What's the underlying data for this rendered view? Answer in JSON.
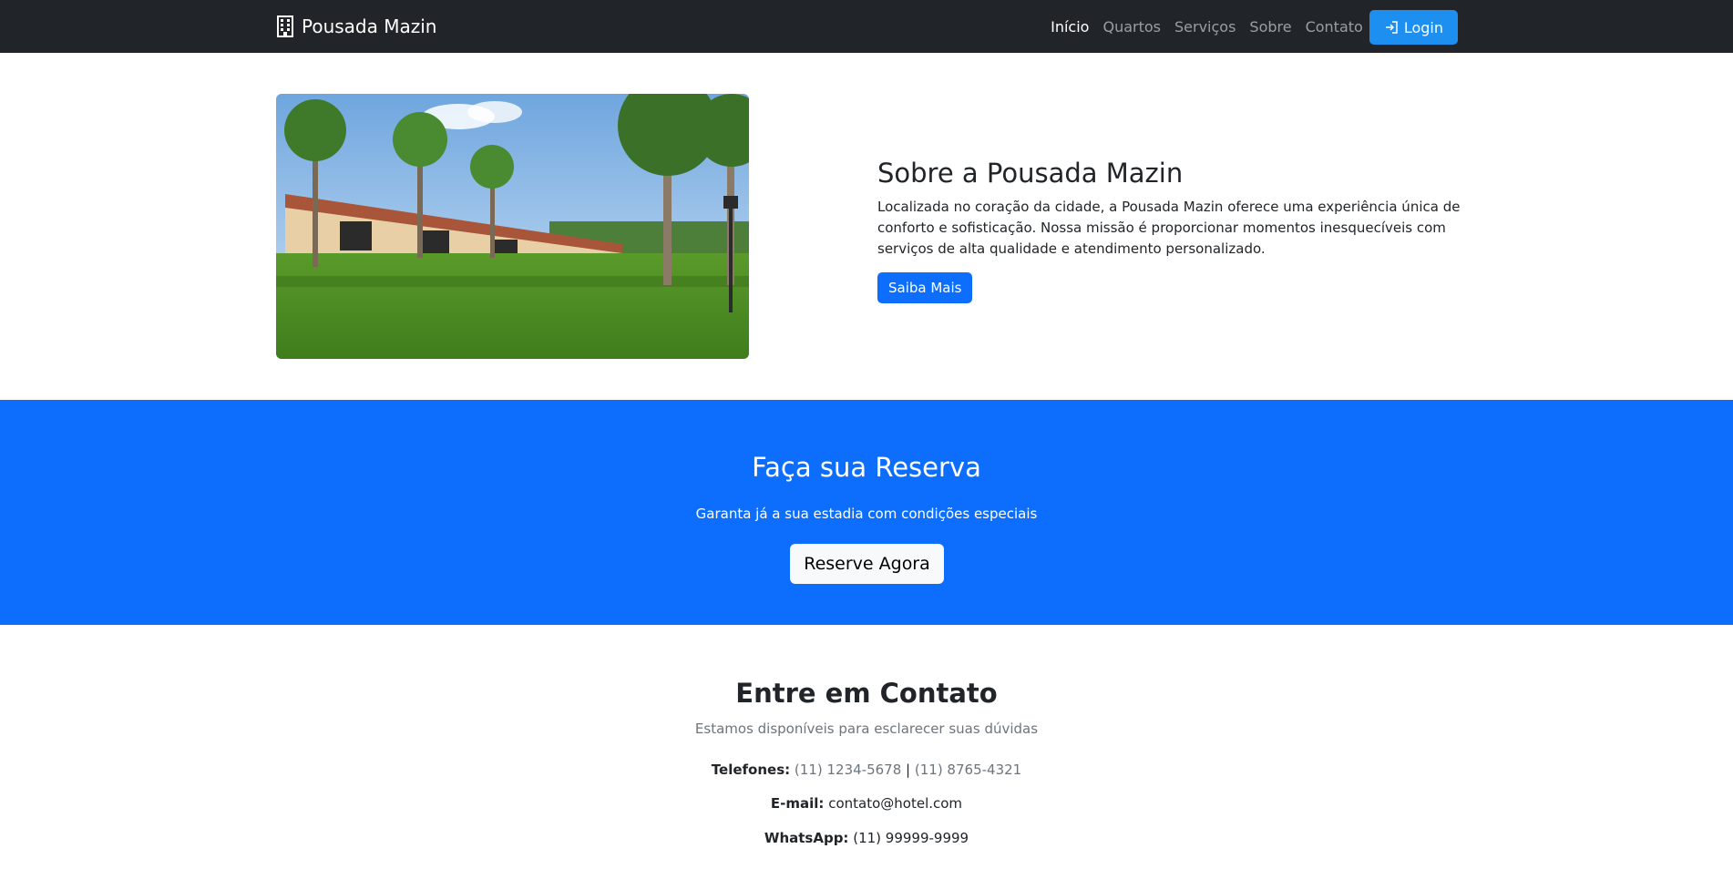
{
  "navbar": {
    "brand": "Pousada Mazin",
    "links": [
      "Início",
      "Quartos",
      "Serviços",
      "Sobre",
      "Contato"
    ],
    "login_label": "Login"
  },
  "about": {
    "title": "Sobre a Pousada Mazin",
    "description": "Localizada no coração da cidade, a Pousada Mazin oferece uma experiência única de conforto e sofisticação. Nossa missão é proporcionar momentos inesquecíveis com serviços de alta qualidade e atendimento personalizado.",
    "button": "Saiba Mais"
  },
  "reserva": {
    "title": "Faça sua Reserva",
    "subtitle": "Garanta já a sua estadia com condições especiais",
    "button": "Reserve Agora"
  },
  "contato": {
    "title": "Entre em Contato",
    "subtitle": "Estamos disponíveis para esclarecer suas dúvidas",
    "phones_label": "Telefones:",
    "phone1": "(11) 1234-5678",
    "separator": "|",
    "phone2": "(11) 8765-4321",
    "email_label": "E-mail:",
    "email": "contato@hotel.com",
    "whatsapp_label": "WhatsApp:",
    "whatsapp": "(11) 99999-9999"
  },
  "colors": {
    "navbar_bg": "#212529",
    "primary": "#0d6efd",
    "login_bg": "#1d8ff0"
  }
}
